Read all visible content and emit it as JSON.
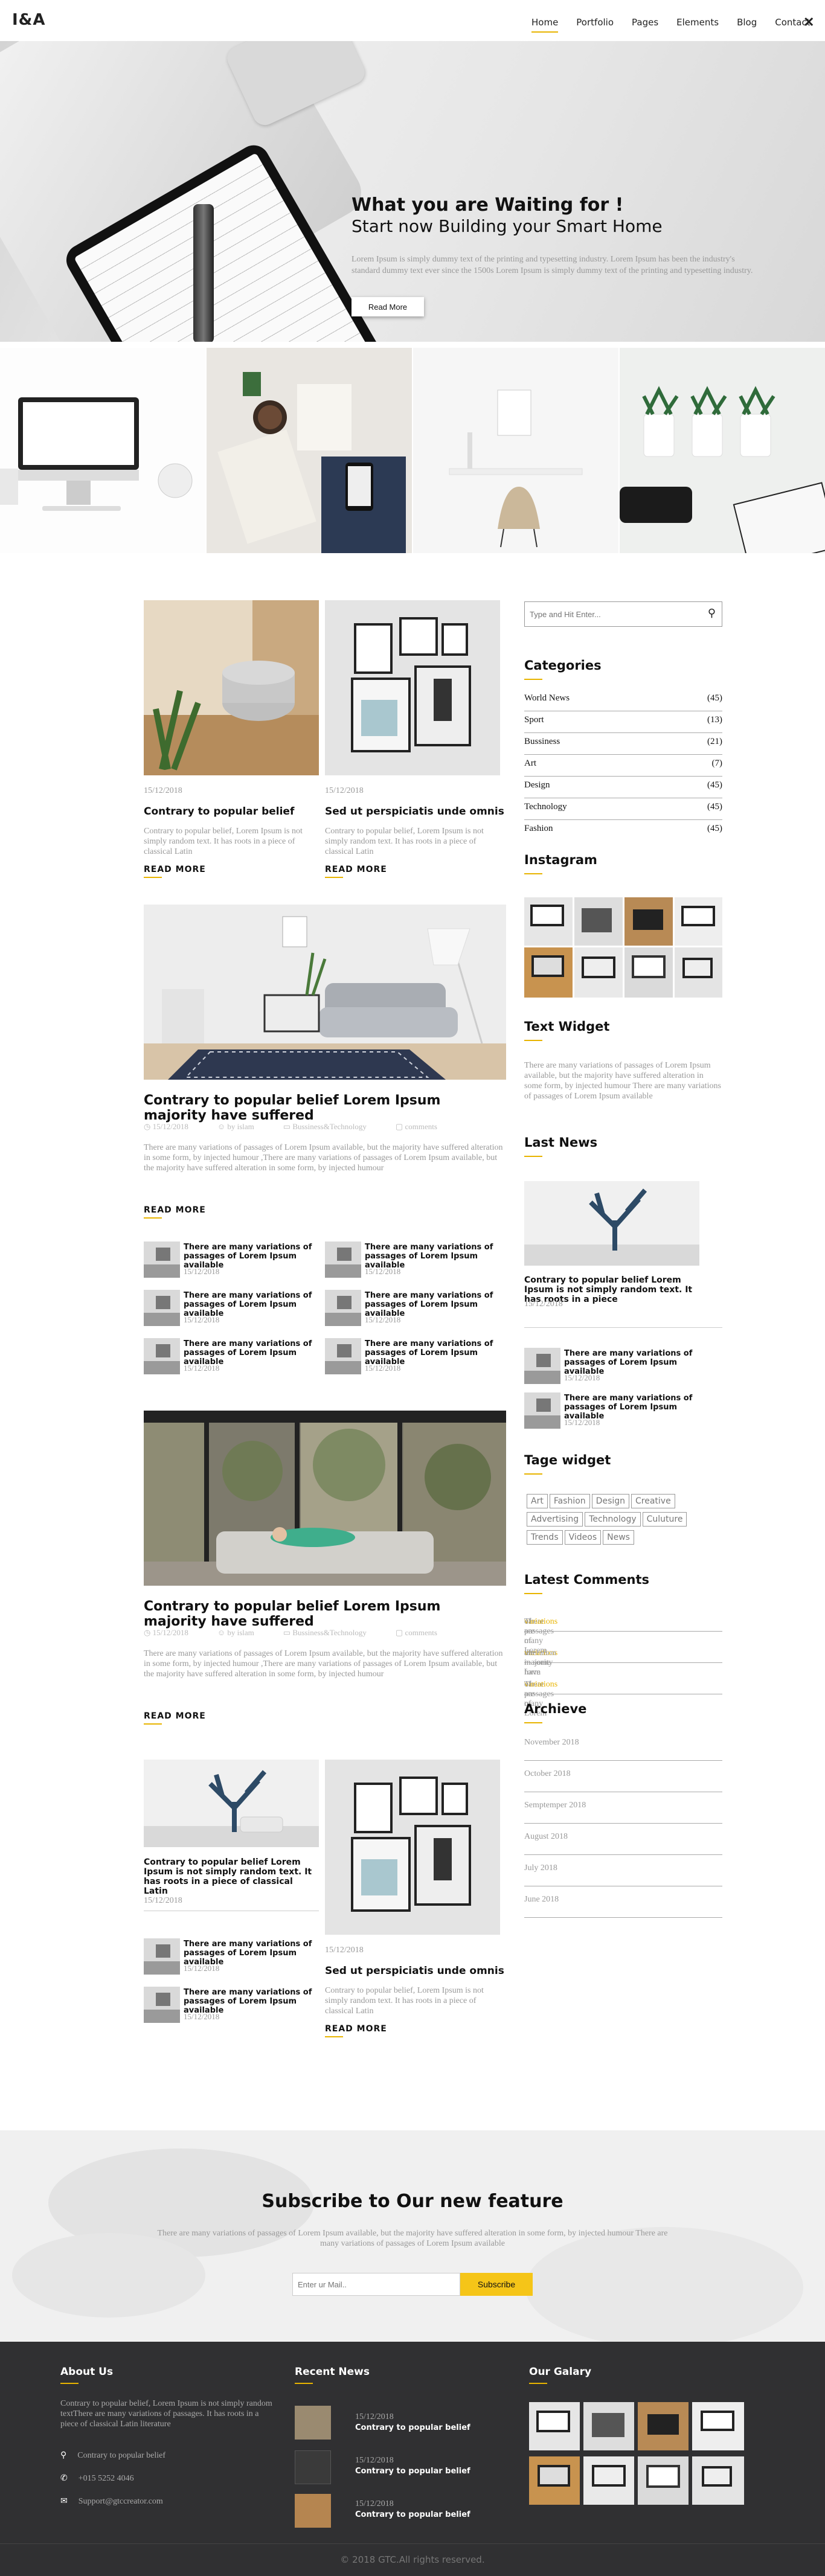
{
  "header": {
    "logo": "I&A",
    "nav": [
      "Home",
      "Portfolio",
      "Pages",
      "Elements",
      "Blog",
      "Contact"
    ],
    "close_icon": "close-icon"
  },
  "hero": {
    "title": "What you are Waiting for !",
    "subtitle": "Start now Building your Smart Home",
    "text": "Lorem Ipsum is simply dummy text of the printing and typesetting industry. Lorem Ipsum has been the industry's standard dummy text ever since the 1500s Lorem Ipsum is simply dummy text of the printing and typesetting industry.",
    "button": "Read More",
    "slides": 3,
    "active_slide": 1
  },
  "posts": {
    "card1": {
      "date": "15/12/2018",
      "title": "Contrary to popular belief",
      "text": "Contrary to popular belief, Lorem Ipsum is not simply random text. It has roots in a piece of classical Latin",
      "read_more": "READ MORE"
    },
    "card2": {
      "date": "15/12/2018",
      "title": "Sed ut perspiciatis unde omnis",
      "text": "Contrary to popular belief, Lorem Ipsum is not simply random text. It has roots in a piece of classical Latin",
      "read_more": "READ MORE"
    },
    "feature1": {
      "title": "Contrary to popular belief Lorem Ipsum majority have suffered",
      "date": "15/12/2018",
      "author": "by islam",
      "category": "Bussiness&Technology",
      "comments": "comments",
      "text": "There are many variations of passages of Lorem Ipsum available, but the majority have suffered alteration in some form, by injected humour ,There are many variations of passages of Lorem Ipsum available, but the majority have suffered alteration in some form, by injected humour",
      "read_more": "READ MORE"
    },
    "mini_items": [
      {
        "title": "There are many variations of passages of Lorem Ipsum available",
        "date": "15/12/2018"
      },
      {
        "title": "There are many variations of passages of Lorem Ipsum available",
        "date": "15/12/2018"
      },
      {
        "title": "There are many variations of passages of Lorem Ipsum available",
        "date": "15/12/2018"
      },
      {
        "title": "There are many variations of passages of Lorem Ipsum available",
        "date": "15/12/2018"
      },
      {
        "title": "There are many variations of passages of Lorem Ipsum available",
        "date": "15/12/2018"
      },
      {
        "title": "There are many variations of passages of Lorem Ipsum available",
        "date": "15/12/2018"
      }
    ],
    "feature2": {
      "title": "Contrary to popular belief Lorem Ipsum majority have suffered",
      "date": "15/12/2018",
      "author": "by islam",
      "category": "Bussiness&Technology",
      "comments": "comments",
      "text": "There are many variations of passages of Lorem Ipsum available, but the majority have suffered alteration in some form, by injected humour ,There are many variations of passages of Lorem Ipsum available, but the majority have suffered alteration in some form, by injected humour",
      "read_more": "READ MORE"
    },
    "card3": {
      "title": "Contrary to popular belief Lorem Ipsum is not simply random text. It has roots in a piece of classical Latin",
      "date": "15/12/2018"
    },
    "card3_minis": [
      {
        "title": "There are many variations of passages of Lorem Ipsum available",
        "date": "15/12/2018"
      },
      {
        "title": "There are many variations of passages of Lorem Ipsum available",
        "date": "15/12/2018"
      }
    ],
    "card4": {
      "date": "15/12/2018",
      "title": "Sed ut perspiciatis unde omnis",
      "text": "Contrary to popular belief, Lorem Ipsum is not simply random text. It has roots in a piece of classical Latin",
      "read_more": "READ MORE"
    }
  },
  "sidebar": {
    "search_placeholder": "Type and Hit Enter...",
    "categories_title": "Categories",
    "categories": [
      {
        "name": "World News",
        "count": "(45)"
      },
      {
        "name": "Sport",
        "count": "(13)"
      },
      {
        "name": "Bussiness",
        "count": "(21)"
      },
      {
        "name": "Art",
        "count": "(7)"
      },
      {
        "name": "Design",
        "count": "(45)"
      },
      {
        "name": "Technology",
        "count": "(45)"
      },
      {
        "name": "Fashion",
        "count": "(45)"
      }
    ],
    "instagram_title": "Instagram",
    "text_widget_title": "Text Widget",
    "text_widget": "There are many variations of passages of Lorem Ipsum available, but the majority have suffered alteration in some form, by injected humour There are many variations of passages of Lorem Ipsum available",
    "last_news_title": "Last News",
    "last_news_main": {
      "title": "Contrary to popular belief Lorem Ipsum is not simply random text. It has roots in a piece",
      "date": "15/12/2018"
    },
    "last_news_items": [
      {
        "title": "There are many variations of passages of Lorem Ipsum available",
        "date": "15/12/2018"
      },
      {
        "title": "There are many variations of passages of Lorem Ipsum available",
        "date": "15/12/2018"
      }
    ],
    "tags_title": "Tage widget",
    "tags": [
      "Art",
      "Fashion",
      "Design",
      "Creative",
      "Advertising",
      "Technology",
      "Culuture",
      "Trends",
      "Videos",
      "News"
    ],
    "latest_comments_title": "Latest Comments",
    "latest_comments": [
      [
        "There are many ",
        "variations",
        " of passages of Lorem"
      ],
      [
        "the majority have ",
        "variations",
        " alteration in some form"
      ],
      [
        "There are many ",
        "variations",
        " of passages of Lorem"
      ]
    ],
    "archive_title": "Archieve",
    "archive": [
      "November 2018",
      "October 2018",
      "Semptemper 2018",
      "August 2018",
      "July 2018",
      "June 2018"
    ]
  },
  "subscribe": {
    "title": "Subscribe to Our new feature",
    "text": "There are many variations of passages of Lorem Ipsum available, but the majority have suffered alteration in some form, by injected humour There are many variations of passages of Lorem Ipsum available",
    "placeholder": "Enter ur Mail..",
    "button": "Subscribe"
  },
  "footer": {
    "about_title": "About Us",
    "about_text": "Contrary to popular belief, Lorem Ipsum is not simply random textThere are many variations of passages. It has roots in a piece of classical Latin literature",
    "address": "Contrary to popular belief",
    "phone": "+015 5252 4046",
    "email": "Support@gtccreator.com",
    "recent_title": "Recent News",
    "recent": [
      {
        "date": "15/12/2018",
        "title": "Contrary to popular belief"
      },
      {
        "date": "15/12/2018",
        "title": "Contrary to popular belief"
      },
      {
        "date": "15/12/2018",
        "title": "Contrary to popular belief"
      }
    ],
    "gallery_title": "Our Galary",
    "copyright": "© 2018 GTC.All rights reserved."
  },
  "colors": {
    "accent": "#e8b400",
    "subscribe_button": "#f5c518",
    "footer_bg": "#303032"
  }
}
